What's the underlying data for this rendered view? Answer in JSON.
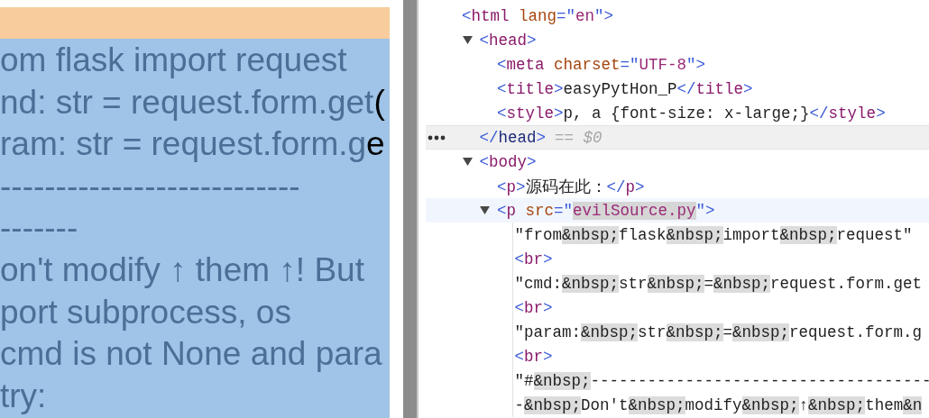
{
  "page": {
    "lines": [
      {
        "text": "om flask import request"
      },
      {
        "text": "nd: str = request.form.get",
        "overflow": "("
      },
      {
        "text": "ram: str = request.form.g",
        "overflow": "e"
      },
      {
        "text": "---------------------------"
      },
      {
        "text": "-------"
      },
      {
        "text": "on't modify ↑ them ↑! But"
      },
      {
        "text": "port subprocess, os"
      },
      {
        "text": "cmd is not None and para"
      },
      {
        "text": "try:"
      }
    ]
  },
  "devtools": {
    "tree": [
      {
        "open": [
          {
            "kind": "punct",
            "t": "<"
          },
          {
            "kind": "tag",
            "t": "html"
          },
          {
            "kind": "attr",
            "t": " lang"
          },
          {
            "kind": "punct",
            "t": "=\""
          },
          {
            "kind": "value",
            "t": "en"
          },
          {
            "kind": "punct",
            "t": "\">"
          }
        ],
        "children": [
          {
            "expanded": true,
            "selected": true,
            "hovered": false,
            "open": [
              {
                "kind": "punct",
                "t": "<"
              },
              {
                "kind": "tag",
                "t": "head"
              },
              {
                "kind": "punct",
                "t": ">"
              }
            ],
            "close": [
              {
                "kind": "punct",
                "t": "</"
              },
              {
                "kind": "tag",
                "t": "head"
              },
              {
                "kind": "punct",
                "t": ">"
              }
            ],
            "selection_marker": "== $0",
            "children": [
              {
                "open": [
                  {
                    "kind": "punct",
                    "t": "<"
                  },
                  {
                    "kind": "tag",
                    "t": "meta"
                  },
                  {
                    "kind": "attr",
                    "t": " charset"
                  },
                  {
                    "kind": "punct",
                    "t": "=\""
                  },
                  {
                    "kind": "value",
                    "t": "UTF-8"
                  },
                  {
                    "kind": "punct",
                    "t": "\">"
                  }
                ]
              },
              {
                "open": [
                  {
                    "kind": "punct",
                    "t": "<"
                  },
                  {
                    "kind": "tag",
                    "t": "title"
                  },
                  {
                    "kind": "punct",
                    "t": ">"
                  },
                  {
                    "kind": "text",
                    "t": "easyPytHon_P"
                  },
                  {
                    "kind": "punct",
                    "t": "</"
                  },
                  {
                    "kind": "tag",
                    "t": "title"
                  },
                  {
                    "kind": "punct",
                    "t": ">"
                  }
                ]
              },
              {
                "open": [
                  {
                    "kind": "punct",
                    "t": "<"
                  },
                  {
                    "kind": "tag",
                    "t": "style"
                  },
                  {
                    "kind": "punct",
                    "t": ">"
                  },
                  {
                    "kind": "text",
                    "t": "p, a {font-size: x-large;}"
                  },
                  {
                    "kind": "punct",
                    "t": "</"
                  },
                  {
                    "kind": "tag",
                    "t": "style"
                  },
                  {
                    "kind": "punct",
                    "t": ">"
                  }
                ]
              }
            ]
          },
          {
            "expanded": true,
            "selected": false,
            "hovered": false,
            "open": [
              {
                "kind": "punct",
                "t": "<"
              },
              {
                "kind": "tag",
                "t": "body"
              },
              {
                "kind": "punct",
                "t": ">"
              }
            ],
            "children": [
              {
                "open": [
                  {
                    "kind": "punct",
                    "t": "<"
                  },
                  {
                    "kind": "tag",
                    "t": "p"
                  },
                  {
                    "kind": "punct",
                    "t": ">"
                  },
                  {
                    "kind": "text",
                    "t": "源码在此："
                  },
                  {
                    "kind": "punct",
                    "t": "</"
                  },
                  {
                    "kind": "tag",
                    "t": "p"
                  },
                  {
                    "kind": "punct",
                    "t": ">"
                  }
                ]
              },
              {
                "expanded": true,
                "selected": false,
                "hovered": true,
                "open": [
                  {
                    "kind": "punct",
                    "t": "<"
                  },
                  {
                    "kind": "tag",
                    "t": "p"
                  },
                  {
                    "kind": "attr",
                    "t": " src"
                  },
                  {
                    "kind": "punct",
                    "t": "=\""
                  },
                  {
                    "kind": "value",
                    "t": "evilSource.py",
                    "highlighted": true
                  },
                  {
                    "kind": "punct",
                    "t": "\">"
                  }
                ],
                "children": [
                  {
                    "open": [
                      {
                        "kind": "text",
                        "t": "\"from"
                      },
                      {
                        "kind": "entity",
                        "t": "&nbsp;"
                      },
                      {
                        "kind": "text",
                        "t": "flask"
                      },
                      {
                        "kind": "entity",
                        "t": "&nbsp;"
                      },
                      {
                        "kind": "text",
                        "t": "import"
                      },
                      {
                        "kind": "entity",
                        "t": "&nbsp;"
                      },
                      {
                        "kind": "text",
                        "t": "request\""
                      }
                    ]
                  },
                  {
                    "open": [
                      {
                        "kind": "punct",
                        "t": "<"
                      },
                      {
                        "kind": "tag",
                        "t": "br"
                      },
                      {
                        "kind": "punct",
                        "t": ">"
                      }
                    ]
                  },
                  {
                    "open": [
                      {
                        "kind": "text",
                        "t": "\"cmd:"
                      },
                      {
                        "kind": "entity",
                        "t": "&nbsp;"
                      },
                      {
                        "kind": "text",
                        "t": "str"
                      },
                      {
                        "kind": "entity",
                        "t": "&nbsp;"
                      },
                      {
                        "kind": "text",
                        "t": "="
                      },
                      {
                        "kind": "entity",
                        "t": "&nbsp;"
                      },
                      {
                        "kind": "text",
                        "t": "request.form.get"
                      }
                    ]
                  },
                  {
                    "open": [
                      {
                        "kind": "punct",
                        "t": "<"
                      },
                      {
                        "kind": "tag",
                        "t": "br"
                      },
                      {
                        "kind": "punct",
                        "t": ">"
                      }
                    ]
                  },
                  {
                    "open": [
                      {
                        "kind": "text",
                        "t": "\"param:"
                      },
                      {
                        "kind": "entity",
                        "t": "&nbsp;"
                      },
                      {
                        "kind": "text",
                        "t": "str"
                      },
                      {
                        "kind": "entity",
                        "t": "&nbsp;"
                      },
                      {
                        "kind": "text",
                        "t": "="
                      },
                      {
                        "kind": "entity",
                        "t": "&nbsp;"
                      },
                      {
                        "kind": "text",
                        "t": "request.form.g"
                      }
                    ]
                  },
                  {
                    "open": [
                      {
                        "kind": "punct",
                        "t": "<"
                      },
                      {
                        "kind": "tag",
                        "t": "br"
                      },
                      {
                        "kind": "punct",
                        "t": ">"
                      }
                    ]
                  },
                  {
                    "open": [
                      {
                        "kind": "text",
                        "t": "\"#"
                      },
                      {
                        "kind": "entity",
                        "t": "&nbsp;"
                      },
                      {
                        "kind": "text",
                        "t": "------------------------------------"
                      }
                    ]
                  },
                  {
                    "open": [
                      {
                        "kind": "text",
                        "t": "-"
                      },
                      {
                        "kind": "entity",
                        "t": "&nbsp;"
                      },
                      {
                        "kind": "text",
                        "t": "Don't"
                      },
                      {
                        "kind": "entity",
                        "t": "&nbsp;"
                      },
                      {
                        "kind": "text",
                        "t": "modify"
                      },
                      {
                        "kind": "entity",
                        "t": "&nbsp;"
                      },
                      {
                        "kind": "text",
                        "t": "↑"
                      },
                      {
                        "kind": "entity",
                        "t": "&nbsp;"
                      },
                      {
                        "kind": "text",
                        "t": "them"
                      },
                      {
                        "kind": "entity",
                        "t": "&n"
                      }
                    ]
                  }
                ]
              }
            ]
          }
        ]
      }
    ]
  }
}
